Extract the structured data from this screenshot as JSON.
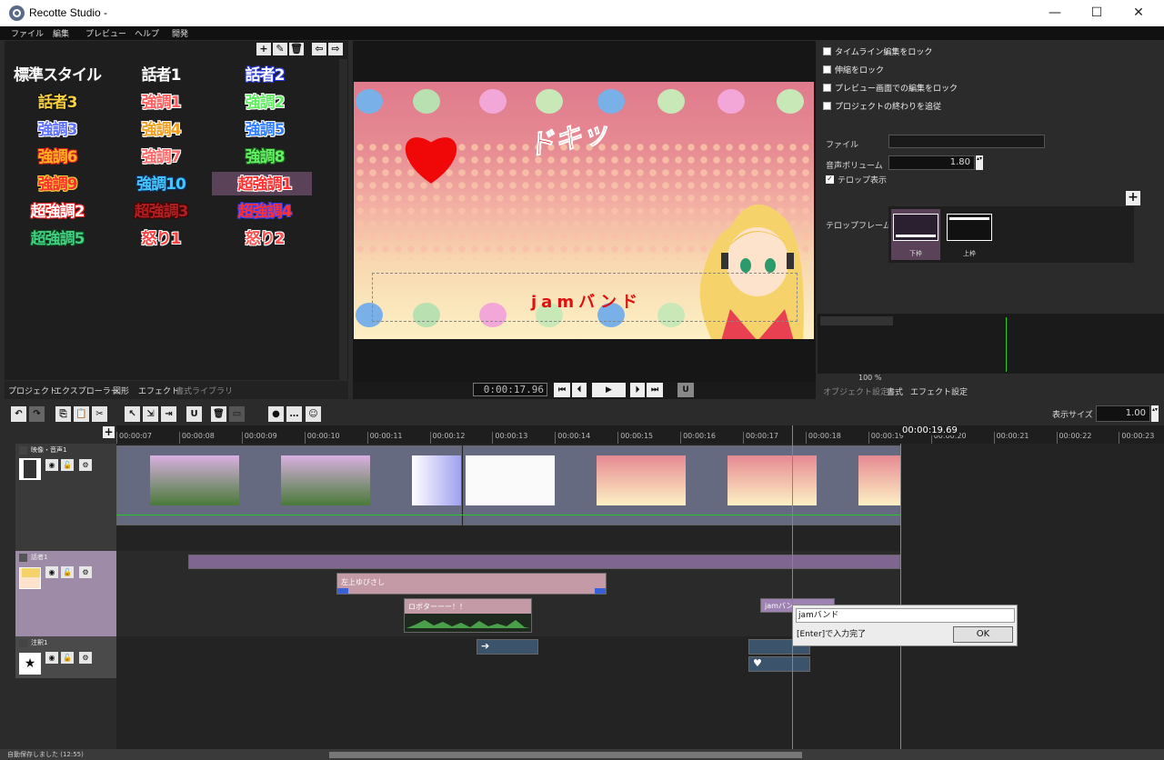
{
  "window": {
    "title": "Recotte Studio -",
    "minimize": "—",
    "maximize": "☐",
    "close": "✕"
  },
  "menu": [
    "ファイル",
    "編集",
    "プレビュー",
    "ヘルプ",
    "開発"
  ],
  "styles": [
    {
      "label": "標準スタイル",
      "color": "#ffffff",
      "stroke": "#222"
    },
    {
      "label": "話者1",
      "color": "#ffffff",
      "stroke": "#222"
    },
    {
      "label": "話者2",
      "color": "#ffffff",
      "stroke": "#2a3ad8"
    },
    {
      "label": "話者3",
      "color": "#f8d040",
      "stroke": "#111"
    },
    {
      "label": "強調1",
      "color": "#ff6060",
      "stroke": "#fff"
    },
    {
      "label": "強調2",
      "color": "#60f060",
      "stroke": "#fff"
    },
    {
      "label": "強調3",
      "color": "#6070ff",
      "stroke": "#fff"
    },
    {
      "label": "強調4",
      "color": "#f0a020",
      "stroke": "#fff"
    },
    {
      "label": "強調5",
      "color": "#3080ff",
      "stroke": "#fff"
    },
    {
      "label": "強調6",
      "color": "#ffb020",
      "stroke": "#d02020"
    },
    {
      "label": "強調7",
      "color": "#ff6a6a",
      "stroke": "#fff"
    },
    {
      "label": "強調8",
      "color": "#60f060",
      "stroke": "#206020"
    },
    {
      "label": "強調9",
      "color": "#ff3030",
      "stroke": "#f8d040"
    },
    {
      "label": "強調10",
      "color": "#40c8ff",
      "stroke": "#103060"
    },
    {
      "label": "超強調1",
      "color": "#ff3030",
      "stroke": "#fff"
    },
    {
      "label": "超強調2",
      "color": "#ffffff",
      "stroke": "#e02020"
    },
    {
      "label": "超強調3",
      "color": "#b02020",
      "stroke": "#400"
    },
    {
      "label": "超強調4",
      "color": "#ff3030",
      "stroke": "#3040ff"
    },
    {
      "label": "超強調5",
      "color": "#40d080",
      "stroke": "#104020"
    },
    {
      "label": "怒り1",
      "color": "#ff4040",
      "stroke": "#fff"
    },
    {
      "label": "怒り2",
      "color": "#ff5050",
      "stroke": "#fff"
    }
  ],
  "leftTabs": [
    "プロジェクト",
    "エクスプローラー",
    "図形",
    "エフェクト",
    "書式ライブラリ"
  ],
  "preview": {
    "sfx": "ドキッ",
    "telop": "jamバンド",
    "timecode": "0:00:17.96"
  },
  "props": {
    "checks": [
      "タイムライン編集をロック",
      "伸縮をロック",
      "プレビュー画面での編集をロック",
      "プロジェクトの終わりを追従"
    ],
    "file_label": "ファイル",
    "file_value": "",
    "vol_label": "音声ボリューム",
    "vol_value": "1.80",
    "telop_show": "テロップ表示",
    "frame_label": "テロップフレーム",
    "frame_opts": [
      "下枠",
      "上枠"
    ]
  },
  "zoom": "100 %",
  "rightTabs": [
    "オブジェクト設定",
    "書式",
    "エフェクト設定"
  ],
  "display_size_label": "表示サイズ",
  "display_size": "1.00",
  "ruler": [
    "00:00:07",
    "00:00:08",
    "00:00:09",
    "00:00:10",
    "00:00:11",
    "00:00:12",
    "00:00:13",
    "00:00:14",
    "00:00:15",
    "00:00:16",
    "00:00:17",
    "00:00:18",
    "00:00:19",
    "00:00:20",
    "00:00:21",
    "00:00:22",
    "00:00:23"
  ],
  "ruler_marker": "00:00:19.69",
  "tracks": [
    "映像・音声1",
    "話者1",
    "注釈1"
  ],
  "clips": {
    "c1": "左上ゆびさし",
    "c2": "ロボターーー！！",
    "c3": "jamバン"
  },
  "popup": {
    "input": "jamバンド",
    "hint": "[Enter]で入力完了",
    "ok": "OK"
  },
  "status": "自動保存しました (12:55)"
}
